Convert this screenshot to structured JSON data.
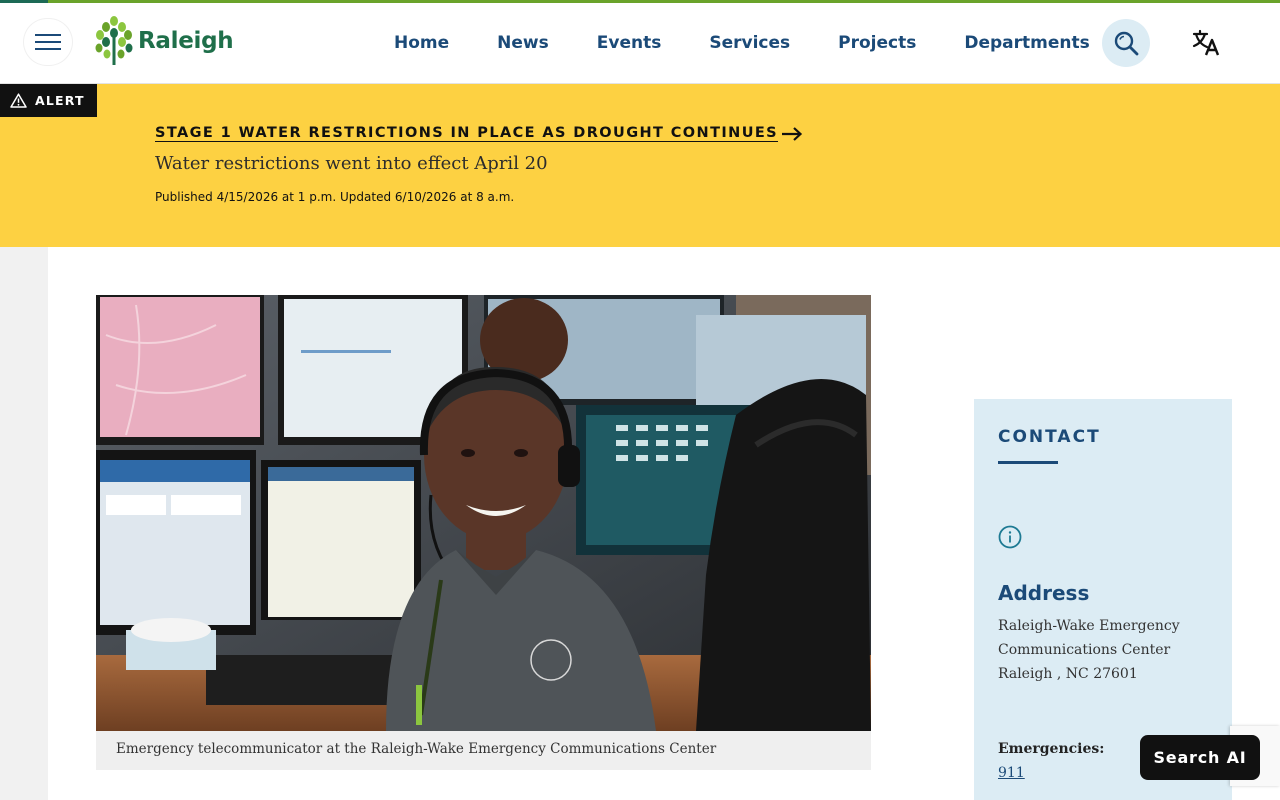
{
  "header": {
    "logo_text": "Raleigh",
    "nav": [
      "Home",
      "News",
      "Events",
      "Services",
      "Projects",
      "Departments"
    ]
  },
  "alert": {
    "tag": "ALERT",
    "title": "STAGE 1 WATER RESTRICTIONS IN PLACE AS DROUGHT CONTINUES",
    "subtitle": "Water restrictions went into effect April 20",
    "meta": "Published 4/15/2026 at 1 p.m.  Updated 6/10/2026 at 8 a.m."
  },
  "photo": {
    "caption": "Emergency telecommunicator at the Raleigh-Wake Emergency Communications Center"
  },
  "contact": {
    "heading": "CONTACT",
    "address_heading": "Address",
    "address_lines": [
      "Raleigh-Wake Emergency",
      "Communications Center",
      "Raleigh , NC 27601"
    ],
    "emergencies_label": "Emergencies:",
    "emergencies_number": "911"
  },
  "search_ai_label": "Search AI",
  "colors": {
    "accent_green": "#6aa32a",
    "navy": "#1b4a78",
    "alert_yellow": "#fdd142",
    "light_blue": "#dcecf4"
  }
}
